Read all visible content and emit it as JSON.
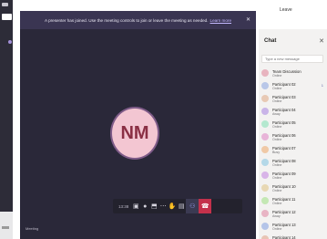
{
  "meeting": {
    "banner_text": "A presenter has joined. Use the meeting controls to join or leave the meeting as needed.",
    "banner_link": "Learn more",
    "avatar_initials": "NM",
    "timer": "13:38",
    "bottom_caption": "Meeting",
    "top_right_label": "Leave"
  },
  "panel": {
    "title": "Chat",
    "search_placeholder": "Type a new message",
    "items": [
      {
        "name": "Team Discussion",
        "sub": "Online",
        "color": "#e8b4bf",
        "badge": ""
      },
      {
        "name": "Participant 02",
        "sub": "Online",
        "color": "#b9c7e8",
        "badge": "1"
      },
      {
        "name": "Participant 03",
        "sub": "Online",
        "color": "#e8c9b4",
        "badge": ""
      },
      {
        "name": "Participant 04",
        "sub": "Away",
        "color": "#c9b4e8",
        "badge": ""
      },
      {
        "name": "Participant 05",
        "sub": "Online",
        "color": "#b4e8cf",
        "badge": ""
      },
      {
        "name": "Participant 06",
        "sub": "Online",
        "color": "#e8b4d8",
        "badge": ""
      },
      {
        "name": "Participant 07",
        "sub": "Busy",
        "color": "#f0c9a6",
        "badge": ""
      },
      {
        "name": "Participant 08",
        "sub": "Online",
        "color": "#b4d8e8",
        "badge": ""
      },
      {
        "name": "Participant 09",
        "sub": "Online",
        "color": "#d8b4e8",
        "badge": ""
      },
      {
        "name": "Participant 10",
        "sub": "Online",
        "color": "#e8d8b4",
        "badge": ""
      },
      {
        "name": "Participant 11",
        "sub": "Online",
        "color": "#c4e8b4",
        "badge": ""
      },
      {
        "name": "Participant 12",
        "sub": "Away",
        "color": "#e8b4c4",
        "badge": ""
      },
      {
        "name": "Participant 13",
        "sub": "Online",
        "color": "#b4c4e8",
        "badge": ""
      },
      {
        "name": "Participant 14",
        "sub": "Online",
        "color": "#e8c4b4",
        "badge": ""
      }
    ]
  },
  "colors": {
    "stage": "#2a2839",
    "accent": "#6264a7",
    "hangup": "#c4314b",
    "avatar_bg": "#f3c6d2",
    "avatar_fg": "#8a2f44"
  }
}
